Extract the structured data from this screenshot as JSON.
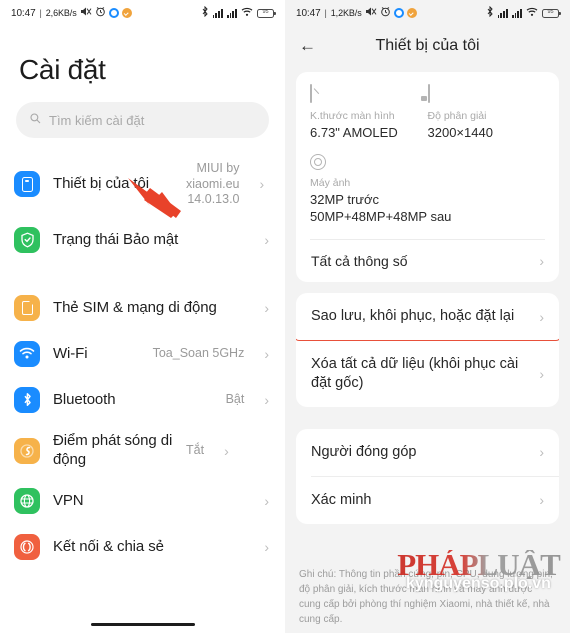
{
  "left": {
    "status_bar": {
      "time": "10:47",
      "separator": "|",
      "data_rate": "2,6KB/s",
      "battery_level": "95",
      "icons": [
        "mute-icon",
        "alarm-icon",
        "blue-dot-icon",
        "orange-check-icon",
        "bluetooth-icon",
        "signal-bars-icon",
        "signal-bars-2-icon",
        "wifi-icon",
        "battery-icon"
      ]
    },
    "title": "Cài đặt",
    "search": {
      "placeholder": "Tìm kiếm cài đặt",
      "icon": "search-icon"
    },
    "groups": [
      {
        "items": [
          {
            "label": "Thiết bị của tôi",
            "value": "MIUI by\nxiaomi.eu\n14.0.13.0",
            "icon": "phone-icon",
            "icon_color": "#1a8cff"
          },
          {
            "label": "Trạng thái Bảo mật",
            "value": "",
            "icon": "shield-check-icon",
            "icon_color": "#2fc15f"
          }
        ]
      },
      {
        "items": [
          {
            "label": "Thẻ SIM & mạng di động",
            "value": "",
            "icon": "sim-card-icon",
            "icon_color": "#f6b24a"
          },
          {
            "label": "Wi-Fi",
            "value": "Toa_Soan 5GHz",
            "icon": "wifi-icon",
            "icon_color": "#1a8cff"
          },
          {
            "label": "Bluetooth",
            "value": "Bật",
            "icon": "bluetooth-icon",
            "icon_color": "#1a8cff"
          },
          {
            "label": "Điểm phát sóng di động",
            "value": "Tắt",
            "icon": "hotspot-icon",
            "icon_color": "#f6b24a"
          },
          {
            "label": "VPN",
            "value": "",
            "icon": "globe-icon",
            "icon_color": "#2fc15f"
          },
          {
            "label": "Kết nối & chia sẻ",
            "value": "",
            "icon": "share-icon",
            "icon_color": "#f0603f"
          }
        ]
      }
    ],
    "annotation": {
      "arrow_color": "#e8422a",
      "points_to": "Thiết bị của tôi"
    }
  },
  "right": {
    "status_bar": {
      "time": "10:47",
      "separator": "|",
      "data_rate": "1,2KB/s",
      "battery_level": "95"
    },
    "back_icon": "back-arrow-icon",
    "title": "Thiết bị của tôi",
    "specs": [
      {
        "icon": "screen-size-icon",
        "label": "K.thước màn hình",
        "value": "6.73\" AMOLED"
      },
      {
        "icon": "resolution-icon",
        "label": "Độ phân giải",
        "value": "3200×1440"
      },
      {
        "icon": "camera-icon",
        "label": "Máy ảnh",
        "value": "32MP trước\n50MP+48MP+48MP sau"
      }
    ],
    "all_specs_row": "Tất cả thông số",
    "actions": [
      {
        "label": "Sao lưu, khôi phục, hoặc đặt lại",
        "highlighted": true
      },
      {
        "label": "Xóa tất cả dữ liệu (khôi phục cài đặt gốc)",
        "highlighted": false
      }
    ],
    "links": [
      {
        "label": "Người đóng góp"
      },
      {
        "label": "Xác minh"
      }
    ],
    "note": "Ghi chú: Thông tin phần cứng, pin, CPU, dung lượng pin, độ phân giải, kích thước màn hình và máy ảnh được cung cấp bởi phòng thí nghiệm Xiaomi, nhà thiết kế, nhà cung cấp.",
    "watermark": {
      "main": "PHÁPLUẬT",
      "sub": "kynguyenso.plo.vn"
    },
    "highlight_color": "#e8503a"
  },
  "glyphs": {
    "chevron": "›",
    "back": "←",
    "search": "⌕",
    "mute": "🔇",
    "alarm": "⏰",
    "bluetooth": "✳",
    "wifi": "📶",
    "globe": "⊕",
    "share": "⟨⟩",
    "hotspot": "◎",
    "shield": "✓",
    "bt": "✲"
  }
}
